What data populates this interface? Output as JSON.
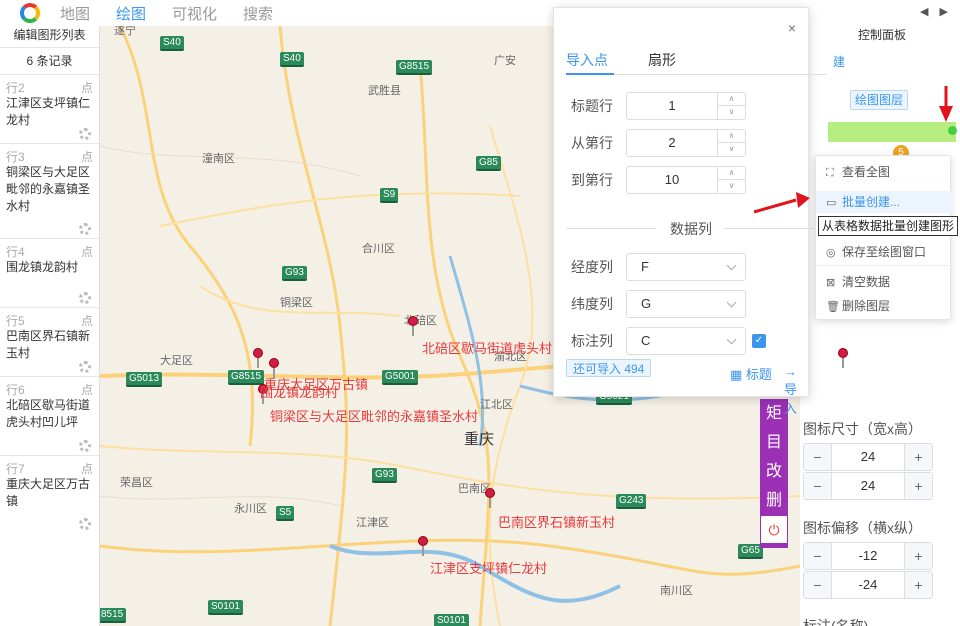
{
  "nav": {
    "tabs": [
      "地图",
      "绘图",
      "可视化",
      "搜索"
    ],
    "active": 1,
    "arrows": "◀ ▶"
  },
  "left_panel": {
    "title": "编辑图形列表",
    "count": "6 条记录",
    "badge_text": "点",
    "rows": [
      {
        "id": "行2",
        "name": "江津区支坪镇仁龙村"
      },
      {
        "id": "行3",
        "name": "铜梁区与大足区毗邻的永嘉镇圣水村"
      },
      {
        "id": "行4",
        "name": "围龙镇龙韵村"
      },
      {
        "id": "行5",
        "name": "巴南区界石镇新玉村"
      },
      {
        "id": "行6",
        "name": "北碚区歇马街道虎头村凹儿坪"
      },
      {
        "id": "行7",
        "name": "重庆大足区万古镇"
      }
    ]
  },
  "map": {
    "places": [
      "遂宁",
      "广安",
      "武胜县",
      "潼南区",
      "合川区",
      "铜梁区",
      "北碚区",
      "渝北区",
      "大足区",
      "江北区",
      "重庆",
      "荣昌区",
      "永川区",
      "江津区",
      "巴南区",
      "南川区"
    ],
    "highways": [
      "S40",
      "S40",
      "G8515",
      "G85",
      "S9",
      "G93",
      "G5013",
      "G8515",
      "G5001",
      "G93",
      "S5",
      "G243",
      "G65",
      "S0101",
      "S0101",
      "8515",
      "G5021"
    ],
    "pin_labels": [
      "重庆大足区万古镇",
      "围龙镇龙韵村",
      "铜梁区与大足区毗邻的永嘉镇圣水村",
      "北碚区歇马街道虎头村",
      "巴南区界石镇新玉村",
      "江津区支坪镇仁龙村"
    ]
  },
  "vertical_toolbar": [
    "矩",
    "目",
    "改",
    "删",
    "⏻"
  ],
  "right_panel": {
    "title": "控制面板",
    "link": "建",
    "draw_layer_button": "绘图图层",
    "badge": "5",
    "icon_size_label": "图标尺寸（宽x高）",
    "icon_width": "24",
    "icon_height": "24",
    "icon_offset_label": "图标偏移（横x纵）",
    "offset_x": "-12",
    "offset_y": "-24",
    "annotation_label": "标注(名称)"
  },
  "dialog": {
    "tabs": [
      "导入点",
      "扇形"
    ],
    "title_row_label": "标题行",
    "title_row": "1",
    "from_row_label": "从第行",
    "from_row": "2",
    "to_row_label": "到第行",
    "to_row": "10",
    "section": "数据列",
    "lng_label": "经度列",
    "lng_col": "F",
    "lat_label": "纬度列",
    "lat_col": "G",
    "mark_label": "标注列",
    "mark_col": "C",
    "importable": "还可导入 494",
    "title_btn": "标题",
    "import_btn": "导入",
    "close": "×"
  },
  "menu": {
    "items": [
      "查看全图",
      "批量创建...",
      "保存至绘图窗口",
      "清空数据",
      "删除图层"
    ],
    "highlighted": 1
  },
  "tooltip": "从表格数据批量创建图形",
  "colors": {
    "accent": "#3b96f0",
    "pin": "#d01c4b",
    "toolbar": "#9b30b5",
    "highway": "#2a8a5a",
    "red_arrow": "#e0141c"
  }
}
